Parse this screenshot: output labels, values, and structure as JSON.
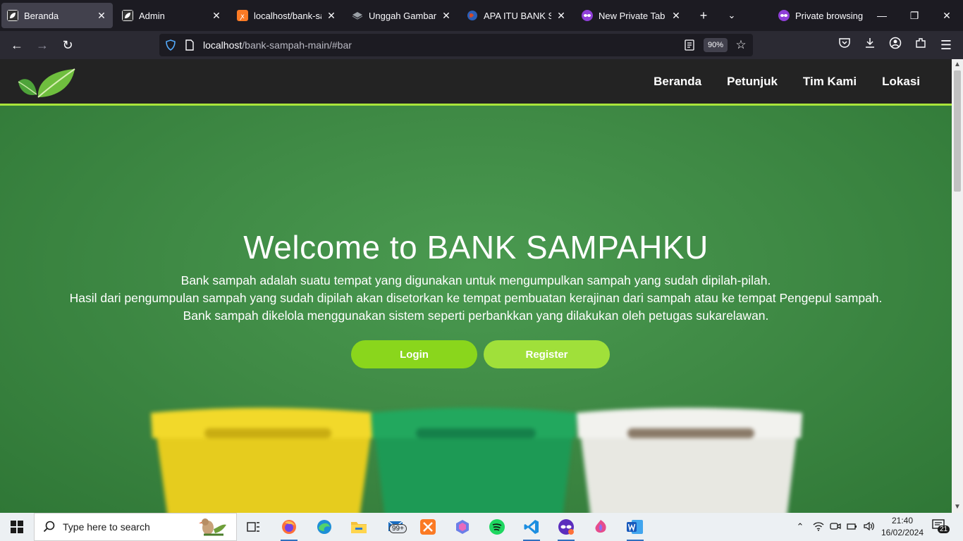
{
  "browser": {
    "tabs": [
      {
        "label": "Beranda",
        "active": true,
        "favicon": "leaf-favicon"
      },
      {
        "label": "Admin",
        "active": false,
        "favicon": "leaf-favicon"
      },
      {
        "label": "localhost/bank-sam",
        "active": false,
        "favicon": "xampp-favicon"
      },
      {
        "label": "Unggah Gambar – r",
        "active": false,
        "favicon": "layers-favicon"
      },
      {
        "label": "APA ITU BANK SAM",
        "active": false,
        "favicon": "earth-favicon"
      },
      {
        "label": "New Private Tab",
        "active": false,
        "favicon": "private-mask-favicon"
      }
    ],
    "private_label": "Private browsing",
    "url_host": "localhost",
    "url_path": "/bank-sampah-main/#bar",
    "zoom": "90%"
  },
  "site": {
    "nav": [
      "Beranda",
      "Petunjuk",
      "Tim Kami",
      "Lokasi"
    ],
    "hero_title": "Welcome to BANK SAMPAHKU",
    "hero_lines": [
      "Bank sampah adalah suatu tempat yang digunakan untuk mengumpulkan sampah yang sudah dipilah-pilah.",
      "Hasil dari pengumpulan sampah yang sudah dipilah akan disetorkan ke tempat pembuatan kerajinan dari sampah atau ke tempat Pengepul sampah.",
      "Bank sampah dikelola menggunakan sistem seperti perbankkan yang dilakukan oleh petugas sukarelawan."
    ],
    "login_label": "Login",
    "register_label": "Register",
    "colors": {
      "header": "#232323",
      "accent": "#a9e53b",
      "hero": "#3f8a45",
      "button": "#8ad61c"
    }
  },
  "taskbar": {
    "search_placeholder": "Type here to search",
    "mail_badge": "99+",
    "notif_badge": "21",
    "time": "21:40",
    "date": "16/02/2024",
    "apps": [
      "task-view",
      "firefox",
      "edge",
      "file-explorer",
      "mail",
      "xampp",
      "copilot",
      "spotify",
      "vscode",
      "firefox-private",
      "firefox-dev",
      "word"
    ]
  }
}
